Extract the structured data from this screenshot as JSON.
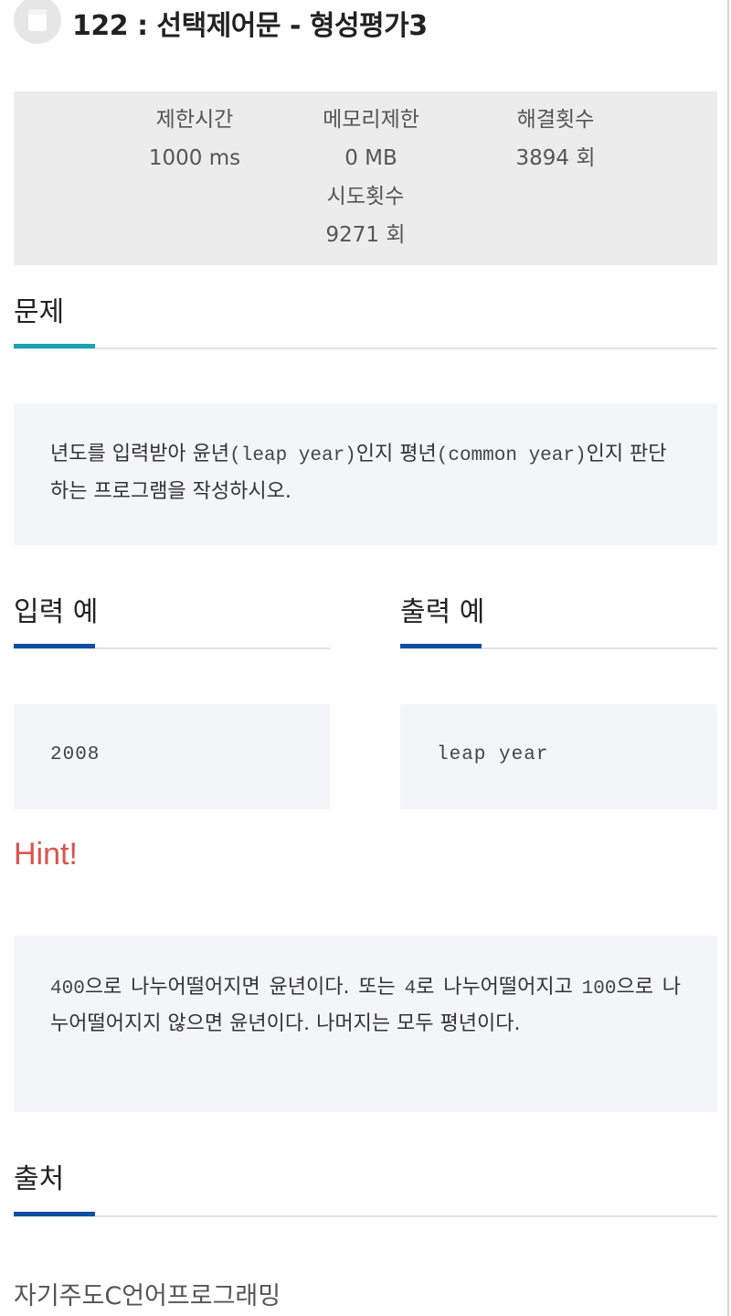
{
  "header": {
    "title": "122 : 선택제어문 - 형성평가3",
    "icon": "book-icon"
  },
  "stats": {
    "time_limit_label": "제한시간",
    "time_limit_value": "1000 ms",
    "memory_limit_label": "메모리제한",
    "memory_limit_value": "0 MB",
    "solved_label": "해결횟수",
    "solved_value": "3894 회",
    "attempts_label": "시도횟수",
    "attempts_value": "9271 회"
  },
  "problem": {
    "heading": "문제",
    "accent_color": "#1aa3b0",
    "text_part1": "년도를 입력받아 윤년",
    "text_mono1": "(leap year)",
    "text_part2": "인지 평년",
    "text_mono2": "(common year)",
    "text_part3": "인지 판단하는 프로그램을 작성하시오."
  },
  "input_example": {
    "heading": "입력 예",
    "value": "2008",
    "accent_color": "#0b4ea2"
  },
  "output_example": {
    "heading": "출력 예",
    "value": "leap year",
    "accent_color": "#0b4ea2"
  },
  "hint": {
    "heading": "Hint!",
    "color": "#d9534f",
    "n400": "400",
    "t1": "으로 나누어떨어지면 윤년이다. 또는 ",
    "n4": "4",
    "t2": "로 나누어떨어지고 ",
    "n100": "100",
    "t3": "으로 나누어떨어지지 않으면 윤년이다. 나머지는 모두 평년이다."
  },
  "source": {
    "heading": "출처",
    "value": "자기주도C언어프로그래밍",
    "accent_color": "#0b4ea2"
  }
}
